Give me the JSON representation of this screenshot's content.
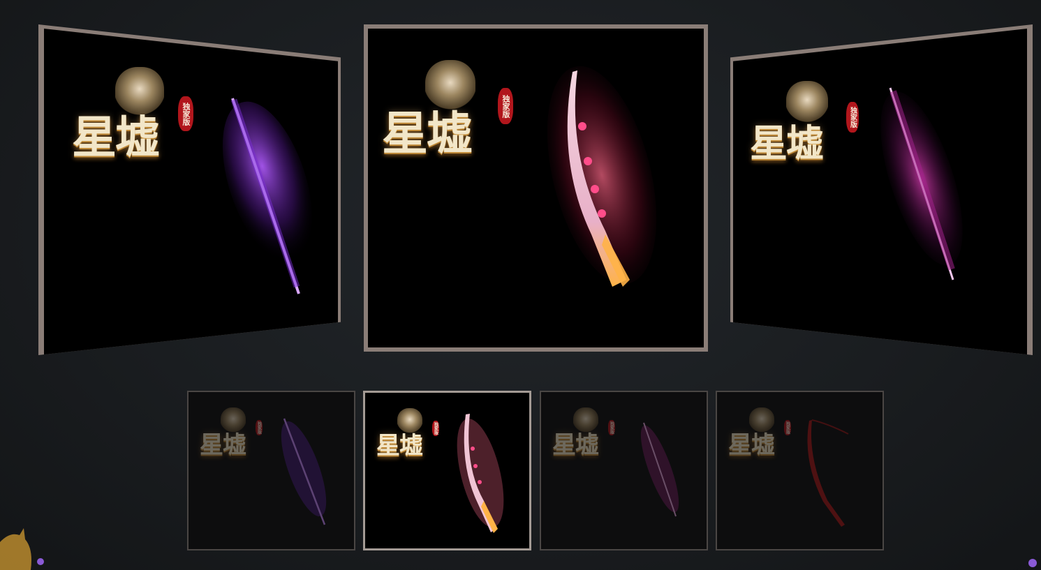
{
  "logo": {
    "title": "星墟",
    "seal": "独家版"
  },
  "colors": {
    "frame": "#8a7d77",
    "thumb_border": "#4a4644",
    "thumb_active_border": "#a39a94",
    "weapon_purple": "#9a3cff",
    "weapon_magenta": "#c02aa0",
    "weapon_pink": "#f0a0c0",
    "weapon_red": "#c41a1a"
  },
  "carousel": {
    "slides": [
      {
        "weapon": "purple-spear-icon"
      },
      {
        "weapon": "pink-flame-blade-icon"
      },
      {
        "weapon": "magenta-sword-icon"
      }
    ],
    "thumbnails": [
      {
        "weapon": "purple-spear-icon",
        "active": false
      },
      {
        "weapon": "pink-flame-blade-icon",
        "active": true
      },
      {
        "weapon": "magenta-sword-icon",
        "active": false
      },
      {
        "weapon": "red-scimitar-icon",
        "active": false
      }
    ]
  }
}
